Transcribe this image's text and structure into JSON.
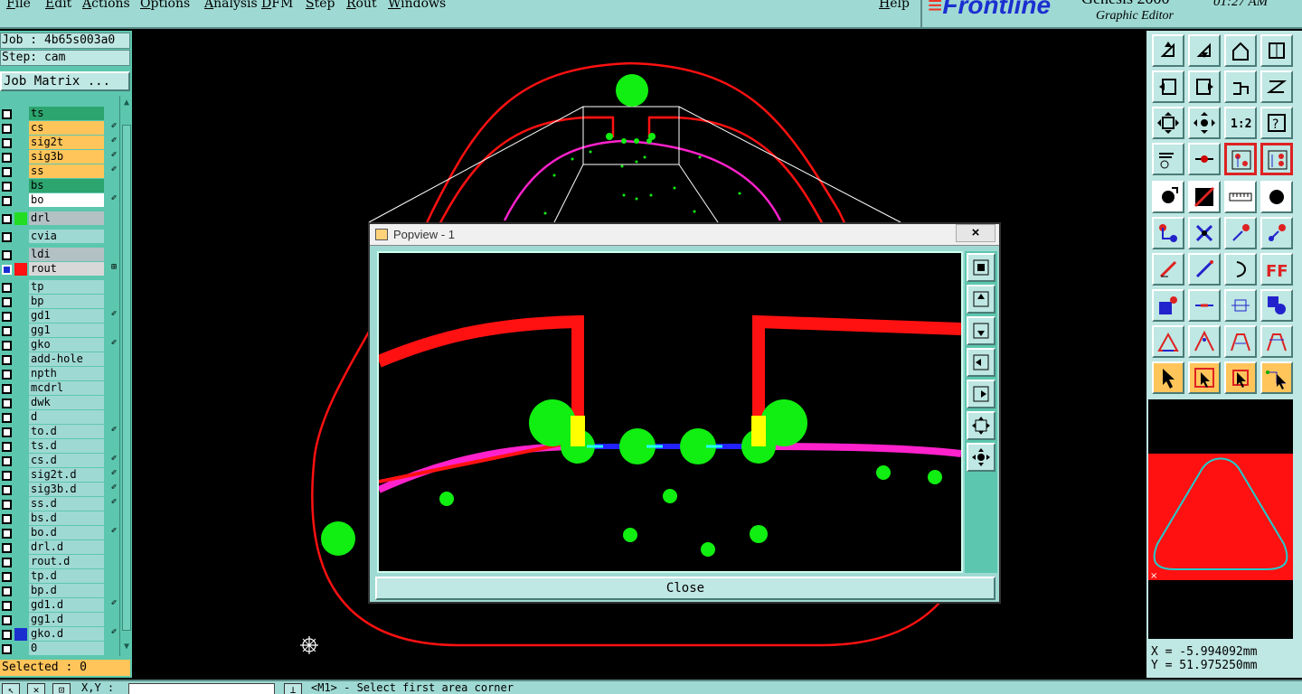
{
  "menubar": {
    "items": [
      "File",
      "Edit",
      "Actions",
      "Options",
      "Analysis",
      "DFM",
      "Step",
      "Rout",
      "Windows"
    ],
    "help": "Help"
  },
  "brand": {
    "logo": "Frontline",
    "product": "Genesis 2000",
    "subtitle": "Graphic Editor",
    "clock": "01:27 AM"
  },
  "job": {
    "job_label": "Job : 4b65s003a0",
    "step_label": "Step: cam",
    "job_matrix": "Job Matrix ..."
  },
  "layers": [
    {
      "name": "ts",
      "style": "sel",
      "pol": "",
      "checked": false,
      "color": ""
    },
    {
      "name": "cs",
      "style": "board",
      "pol": "✐",
      "checked": false,
      "color": ""
    },
    {
      "name": "sig2t",
      "style": "board",
      "pol": "✐",
      "checked": false,
      "color": ""
    },
    {
      "name": "sig3b",
      "style": "board",
      "pol": "✐",
      "checked": false,
      "color": ""
    },
    {
      "name": "ss",
      "style": "board",
      "pol": "✐",
      "checked": false,
      "color": ""
    },
    {
      "name": "bs",
      "style": "sel",
      "pol": "",
      "checked": false,
      "color": ""
    },
    {
      "name": "bo",
      "style": "white",
      "pol": "✐",
      "checked": false,
      "color": ""
    },
    {
      "name": "drl",
      "style": "gray",
      "pol": "",
      "checked": false,
      "color": "#22dd22"
    },
    {
      "name": "cvia",
      "style": "plain",
      "pol": "",
      "checked": false,
      "color": ""
    },
    {
      "name": "ldi",
      "style": "gray",
      "pol": "",
      "checked": false,
      "color": ""
    },
    {
      "name": "rout",
      "style": "lgray",
      "pol": "⊞",
      "checked": true,
      "color": "#ff1111"
    },
    {
      "name": "tp",
      "style": "plain",
      "pol": "",
      "checked": false,
      "color": ""
    },
    {
      "name": "bp",
      "style": "plain",
      "pol": "",
      "checked": false,
      "color": ""
    },
    {
      "name": "gd1",
      "style": "plain",
      "pol": "✐",
      "checked": false,
      "color": ""
    },
    {
      "name": "gg1",
      "style": "plain",
      "pol": "",
      "checked": false,
      "color": ""
    },
    {
      "name": "gko",
      "style": "plain",
      "pol": "✐",
      "checked": false,
      "color": ""
    },
    {
      "name": "add-hole",
      "style": "plain",
      "pol": "",
      "checked": false,
      "color": ""
    },
    {
      "name": "npth",
      "style": "plain",
      "pol": "",
      "checked": false,
      "color": ""
    },
    {
      "name": "mcdrl",
      "style": "plain",
      "pol": "",
      "checked": false,
      "color": ""
    },
    {
      "name": "dwk",
      "style": "plain",
      "pol": "",
      "checked": false,
      "color": ""
    },
    {
      "name": "d",
      "style": "plain",
      "pol": "",
      "checked": false,
      "color": ""
    },
    {
      "name": "to.d",
      "style": "plain",
      "pol": "✐",
      "checked": false,
      "color": ""
    },
    {
      "name": "ts.d",
      "style": "plain",
      "pol": "",
      "checked": false,
      "color": ""
    },
    {
      "name": "cs.d",
      "style": "plain",
      "pol": "✐",
      "checked": false,
      "color": ""
    },
    {
      "name": "sig2t.d",
      "style": "plain",
      "pol": "✐",
      "checked": false,
      "color": ""
    },
    {
      "name": "sig3b.d",
      "style": "plain",
      "pol": "✐",
      "checked": false,
      "color": ""
    },
    {
      "name": "ss.d",
      "style": "plain",
      "pol": "✐",
      "checked": false,
      "color": ""
    },
    {
      "name": "bs.d",
      "style": "plain",
      "pol": "",
      "checked": false,
      "color": ""
    },
    {
      "name": "bo.d",
      "style": "plain",
      "pol": "✐",
      "checked": false,
      "color": ""
    },
    {
      "name": "drl.d",
      "style": "plain",
      "pol": "",
      "checked": false,
      "color": ""
    },
    {
      "name": "rout.d",
      "style": "plain",
      "pol": "",
      "checked": false,
      "color": ""
    },
    {
      "name": "tp.d",
      "style": "plain",
      "pol": "",
      "checked": false,
      "color": ""
    },
    {
      "name": "bp.d",
      "style": "plain",
      "pol": "",
      "checked": false,
      "color": ""
    },
    {
      "name": "gd1.d",
      "style": "plain",
      "pol": "✐",
      "checked": false,
      "color": ""
    },
    {
      "name": "gg1.d",
      "style": "plain",
      "pol": "",
      "checked": false,
      "color": ""
    },
    {
      "name": "gko.d",
      "style": "plain",
      "pol": "✐",
      "checked": false,
      "color": "#1b2fd0"
    },
    {
      "name": "0",
      "style": "plain",
      "pol": "",
      "checked": false,
      "color": ""
    }
  ],
  "selected": "Selected : 0",
  "status": {
    "xy_label": "X,Y :",
    "message": "<M1> - Select first area corner"
  },
  "popview": {
    "title": "Popview - 1",
    "close_label": "Close",
    "close_x": "×"
  },
  "coords": {
    "x": "X = -5.994092mm",
    "y": "Y = 51.975250mm"
  },
  "colors": {
    "rout": "#ff1111",
    "drill": "#11ee11",
    "magenta": "#ff22cc",
    "blue": "#2222ff",
    "cyan": "#22ffff",
    "yellow": "#ffff00",
    "panel": "#9fd9d3"
  },
  "toolbar_icons": [
    "layer-up-icon",
    "layer-down-icon",
    "home-icon",
    "grid-icon",
    "pan-left-icon",
    "pan-right-icon",
    "flip-icon",
    "rotate-icon",
    "fit-all-icon",
    "center-icon",
    "ratio-1-2-icon",
    "help-icon",
    "measure-tool-icon",
    "probe-icon",
    "route-select-icon",
    "route-edit-icon",
    "select-pad-icon",
    "draw-line-icon",
    "ruler-icon",
    "target-icon",
    "connect-icon",
    "cross-icon",
    "move-point-icon",
    "add-point-icon",
    "slash-icon",
    "line-draw-icon",
    "arc-icon",
    "ff-icon",
    "pad-add-icon",
    "line-minus-icon",
    "resize-icon",
    "fill-icon",
    "triangle-a-icon",
    "triangle-b-icon",
    "triangle-c-icon",
    "triangle-d-icon",
    "pointer-icon",
    "pointer-box-icon",
    "pointer-square-icon",
    "pointer-net-icon"
  ]
}
